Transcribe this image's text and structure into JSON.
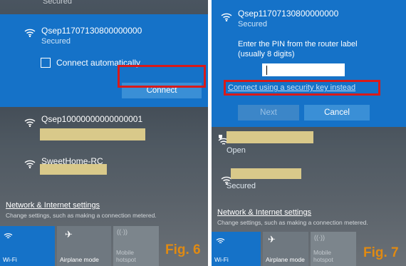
{
  "left": {
    "top_cut_label": "Secured",
    "selected_network": {
      "name": "Qsep11707130800000000",
      "status": "Secured"
    },
    "connect_auto_label": "Connect automatically",
    "connect_button": "Connect",
    "network2": {
      "name": "Qsep10000000000000001"
    },
    "network3": {
      "name": "SweetHome-RC"
    },
    "settings_link": "Network & Internet settings",
    "settings_sub": "Change settings, such as making a connection metered.",
    "tiles": [
      {
        "label": "Wi-Fi",
        "active": true
      },
      {
        "label": "Airplane mode",
        "active": false
      },
      {
        "label": "Mobile hotspot",
        "active": false
      }
    ],
    "fig_label": "Fig. 6"
  },
  "right": {
    "selected_network": {
      "name": "Qsep11707130800000000",
      "status": "Secured"
    },
    "pin_prompt": "Enter the PIN from the router label (usually 8 digits)",
    "pin_value": "",
    "security_key_link": "Connect using a security key instead",
    "next_button": "Next",
    "cancel_button": "Cancel",
    "network2": {
      "status": "Open"
    },
    "network3": {
      "status": "Secured"
    },
    "settings_link": "Network & Internet settings",
    "settings_sub": "Change settings, such as making a connection metered.",
    "tiles": [
      {
        "label": "Wi-Fi",
        "active": true
      },
      {
        "label": "Airplane mode",
        "active": false
      },
      {
        "label": "Mobile hotspot",
        "active": false
      }
    ],
    "fig_label": "Fig. 7"
  },
  "colors": {
    "accent": "#1572c8",
    "highlight": "#d81a1a",
    "fig_text": "#e08a12",
    "redacted": "#d9c98a"
  }
}
